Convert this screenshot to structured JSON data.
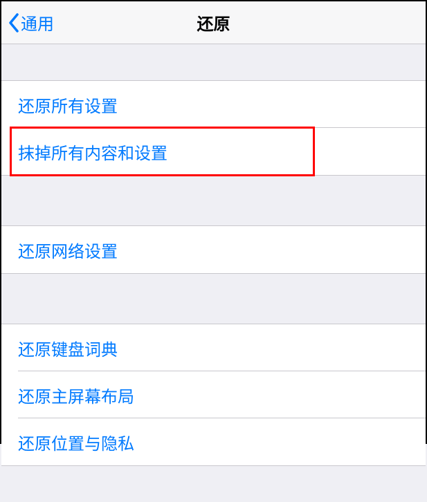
{
  "nav": {
    "back_label": "通用",
    "title": "还原"
  },
  "groups": [
    {
      "items": [
        {
          "label": "还原所有设置"
        },
        {
          "label": "抹掉所有内容和设置"
        }
      ]
    },
    {
      "items": [
        {
          "label": "还原网络设置"
        }
      ]
    },
    {
      "items": [
        {
          "label": "还原键盘词典"
        },
        {
          "label": "还原主屏幕布局"
        },
        {
          "label": "还原位置与隐私"
        }
      ]
    }
  ],
  "highlight": {
    "target_group": 0,
    "target_item": 1
  }
}
